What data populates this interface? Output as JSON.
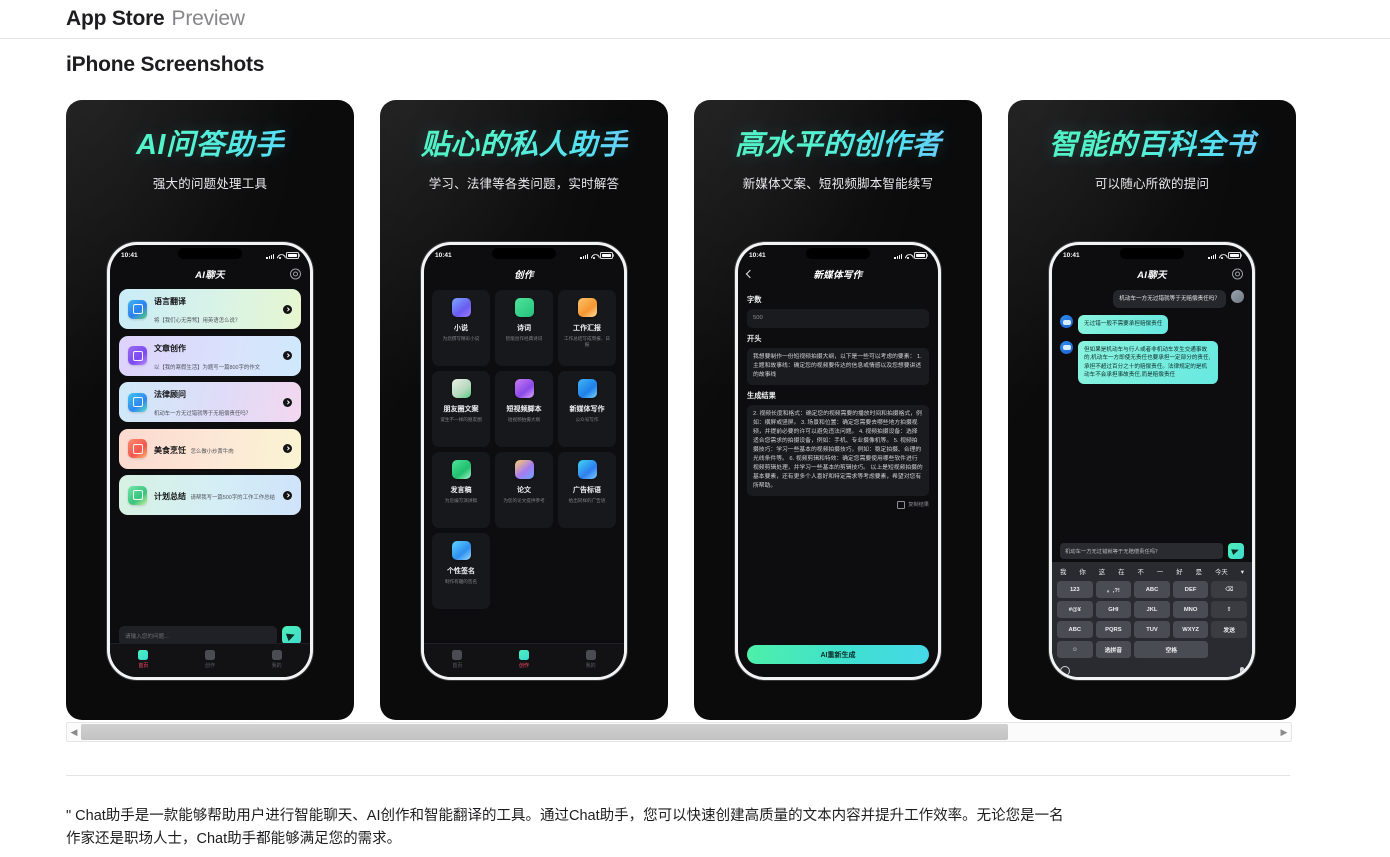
{
  "topbar": {
    "brand": "App Store",
    "section": "Preview"
  },
  "section_title": "iPhone Screenshots",
  "scrollbar": {
    "left_arrow": "◀",
    "right_arrow": "▶"
  },
  "description": "\" Chat助手是一款能够帮助用户进行智能聊天、AI创作和智能翻译的工具。通过Chat助手，您可以快速创建高质量的文本内容并提升工作效率。无论您是一名作家还是职场人士，Chat助手都能够满足您的需求。",
  "colors": {
    "accent_green": "#4ef0c0",
    "accent_blue": "#7fb4ff",
    "tab_active": "#ff4d6a"
  },
  "shots": [
    {
      "title": "AI问答助手",
      "subtitle": "强大的问题处理工具",
      "status_time": "10:41",
      "app_title": "AI聊天",
      "cards": [
        {
          "title": "语言翻译",
          "sub": "将【我们心无旁骛】用英语怎么说？"
        },
        {
          "title": "文章创作",
          "sub": "以【我的寒假生活】为题写一篇800字的作文"
        },
        {
          "title": "法律顾问",
          "sub": "机动车一方无过错就等于无赔偿责任吗？"
        },
        {
          "title": "美食烹饪",
          "sub": "怎么做小炒黄牛肉"
        },
        {
          "title": "计划总结",
          "sub": "请帮我写一篇500字的工作工作总结"
        }
      ],
      "composer_placeholder": "请输入您的问题...",
      "tabs": [
        {
          "label": "首页",
          "active": true
        },
        {
          "label": "创作",
          "active": false
        },
        {
          "label": "我的",
          "active": false
        }
      ]
    },
    {
      "title": "贴心的私人助手",
      "subtitle": "学习、法律等各类问题，实时解答",
      "status_time": "10:41",
      "app_title": "创作",
      "grid": [
        {
          "title": "小说",
          "sub": "为您撰写精彩小说"
        },
        {
          "title": "诗词",
          "sub": "智能创作经典诗词"
        },
        {
          "title": "工作汇报",
          "sub": "工作总结写成周报、日报"
        },
        {
          "title": "朋友圈文案",
          "sub": "诞生不一样的朋友圈"
        },
        {
          "title": "短视频脚本",
          "sub": "短视频拍摄大纲"
        },
        {
          "title": "新媒体写作",
          "sub": "公众号写作"
        },
        {
          "title": "发言稿",
          "sub": "为您编写演讲稿"
        },
        {
          "title": "论文",
          "sub": "为您的论文提供参考"
        },
        {
          "title": "广告标语",
          "sub": "给出同样的广告语"
        },
        {
          "title": "个性签名",
          "sub": "制作有趣的签名"
        }
      ],
      "tabs": [
        {
          "label": "首页",
          "active": false
        },
        {
          "label": "创作",
          "active": true
        },
        {
          "label": "我的",
          "active": false
        }
      ]
    },
    {
      "title": "高水平的创作者",
      "subtitle": "新媒体文案、短视频脚本智能续写",
      "status_time": "10:41",
      "app_title": "新媒体写作",
      "form": {
        "label_count": "字数",
        "value_count": "500",
        "label_intro": "开头",
        "value_intro": "我想要制作一份短视频拍摄大纲，以下是一些可以考虑的要素：\n1. 主题和故事线：确定您的视频要传达的信息或情感以及您想要讲述的故事线",
        "label_result": "生成结果",
        "value_result": "2. 视频长度和格式：确定您的视频需要的播放时间和拍摄格式，例如：横屏或竖屏。\n3. 场景和位置：确定您需要去哪些地方拍摄视频，并提前必要的许可以避免违法问题。\n4. 视频拍摄设备：选择适合您需求的拍摄设备，例如：手机、专业摄像机等。\n5. 视频拍摄技巧：学习一些基本的视频拍摄技巧，例如：稳定拍摄、合理的光线条件等。\n6. 视频剪辑和特效：确定您需要使用哪些软件进行视频剪辑处理，并学习一些基本的剪辑技巧。\n以上是短视频拍摄的基本要素，还有更多个人喜好和特定需求等考虑要素，希望对您有所帮助。",
        "copy_label": "复制结果",
        "regen_label": "AI重新生成"
      }
    },
    {
      "title": "智能的百科全书",
      "subtitle": "可以随心所欲的提问",
      "status_time": "10:41",
      "app_title": "AI聊天",
      "messages": [
        {
          "from": "user",
          "text": "机动车一方无过错就等于无赔偿责任吗？"
        },
        {
          "from": "ai",
          "text": "无过错一般不需要承担赔偿责任"
        },
        {
          "from": "ai",
          "text": "但如果是机动车与行人或者非机动车发生交通事故的,机动车一方即使无责任也要承担一定部分的责任,承担不超过百分之十的赔偿责任。法律规定的是机动车不会承担事故责任,而是赔偿责任"
        }
      ],
      "input_text": "机动车一方无过错就等于无赔偿责任吗？",
      "keyboard": {
        "suggestions": [
          "我",
          "你",
          "这",
          "在",
          "不",
          "一",
          "好",
          "是",
          "今天"
        ],
        "keys": [
          "123",
          "。,?!",
          "ABC",
          "DEF",
          "⌫",
          "#@¥",
          "GHI",
          "JKL",
          "MNO",
          "⇧",
          "ABC",
          "PQRS",
          "TUV",
          "WXYZ",
          "发送",
          "☺",
          "选拼音",
          "空格"
        ]
      }
    }
  ]
}
